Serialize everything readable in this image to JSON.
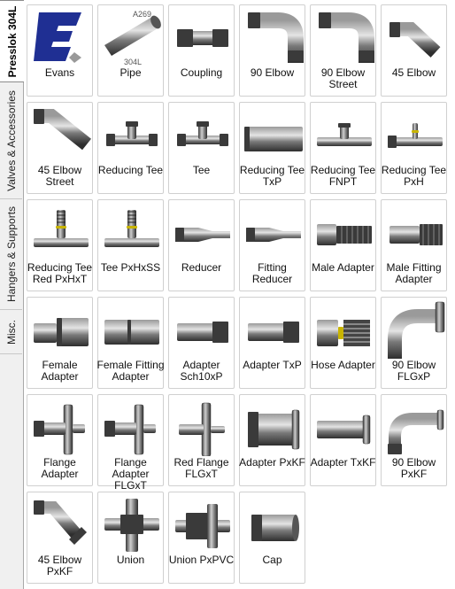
{
  "tabs": [
    {
      "label": "Presslok 304L",
      "active": true
    },
    {
      "label": "Valves & Accessories",
      "active": false
    },
    {
      "label": "Hangers & Supports",
      "active": false
    },
    {
      "label": "Misc.",
      "active": false
    }
  ],
  "logo": {
    "text": "Evans",
    "color": "#1f2f93"
  },
  "pipe_image_text": {
    "top": "A269",
    "bottom": "304L"
  },
  "items": [
    {
      "label": "Evans",
      "icon": "evans-logo-icon"
    },
    {
      "label": "Pipe",
      "icon": "pipe-icon"
    },
    {
      "label": "Coupling",
      "icon": "coupling-icon"
    },
    {
      "label": "90 Elbow",
      "icon": "elbow-90-icon"
    },
    {
      "label": "90 Elbow Street",
      "icon": "elbow-90-street-icon"
    },
    {
      "label": "45 Elbow",
      "icon": "elbow-45-icon"
    },
    {
      "label": "45 Elbow Street",
      "icon": "elbow-45-street-icon"
    },
    {
      "label": "Reducing Tee",
      "icon": "reducing-tee-icon"
    },
    {
      "label": "Tee",
      "icon": "tee-icon"
    },
    {
      "label": "Reducing Tee TxP",
      "icon": "reducing-tee-txp-icon"
    },
    {
      "label": "Reducing Tee FNPT",
      "icon": "reducing-tee-fnpt-icon"
    },
    {
      "label": "Reducing Tee PxH",
      "icon": "reducing-tee-pxh-icon"
    },
    {
      "label": "Reducing Tee Red PxHxT",
      "icon": "reducing-tee-red-icon"
    },
    {
      "label": "Tee PxHxSS",
      "icon": "tee-pxhxss-icon"
    },
    {
      "label": "Reducer",
      "icon": "reducer-icon"
    },
    {
      "label": "Fitting Reducer",
      "icon": "fitting-reducer-icon"
    },
    {
      "label": "Male Adapter",
      "icon": "male-adapter-icon"
    },
    {
      "label": "Male Fitting Adapter",
      "icon": "male-fitting-adapter-icon"
    },
    {
      "label": "Female Adapter",
      "icon": "female-adapter-icon"
    },
    {
      "label": "Female Fitting Adapter",
      "icon": "female-fitting-adapter-icon"
    },
    {
      "label": "Adapter Sch10xP",
      "icon": "adapter-sch10xp-icon"
    },
    {
      "label": "Adapter TxP",
      "icon": "adapter-txp-icon"
    },
    {
      "label": "Hose Adapter",
      "icon": "hose-adapter-icon"
    },
    {
      "label": "90 Elbow FLGxP",
      "icon": "elbow-90-flgxp-icon"
    },
    {
      "label": "Flange Adapter",
      "icon": "flange-adapter-icon"
    },
    {
      "label": "Flange Adapter FLGxT",
      "icon": "flange-adapter-flgxt-icon"
    },
    {
      "label": "Red Flange FLGxT",
      "icon": "red-flange-flgxt-icon"
    },
    {
      "label": "Adapter PxKF",
      "icon": "adapter-pxkf-icon"
    },
    {
      "label": "Adapter TxKF",
      "icon": "adapter-txkf-icon"
    },
    {
      "label": "90 Elbow PxKF",
      "icon": "elbow-90-pxkf-icon"
    },
    {
      "label": "45 Elbow PxKF",
      "icon": "elbow-45-pxkf-icon"
    },
    {
      "label": "Union",
      "icon": "union-icon"
    },
    {
      "label": "Union PxPVC",
      "icon": "union-pxpvc-icon"
    },
    {
      "label": "Cap",
      "icon": "cap-icon"
    }
  ],
  "colors": {
    "metal_dark": "#3a3a3a",
    "metal_light": "#b8b8b8",
    "accent_yellow": "#c8b400"
  }
}
